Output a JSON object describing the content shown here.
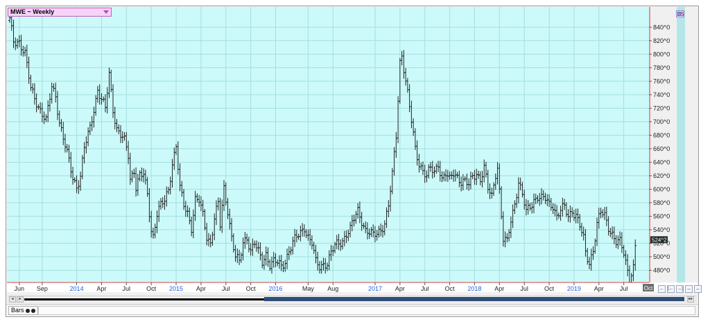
{
  "window": {
    "symbol_label": "MWE ~ Weekly",
    "price_badge": "524^2",
    "current_date_tag": "Oct",
    "bs_badge": {
      "b": "B",
      "s": "S"
    },
    "chart_style_tab": "Bars",
    "nav_buttons": [
      "←",
      "|←",
      "→|",
      "↔",
      "↔"
    ],
    "scroll_arrows": [
      "◂",
      "▸",
      "▸▸"
    ]
  },
  "colors": {
    "plot_bg": "#ccfafa",
    "grid": "#a5dede",
    "bars": "#202020",
    "cursor_line": "#d83030",
    "year_label": "#2060e0",
    "right_panel": "#b3e6e6"
  },
  "chart_data": {
    "type": "bar",
    "style": "OHLC weekly bars",
    "title": "",
    "xlabel": "",
    "ylabel": "",
    "grid": true,
    "ylim": [
      462,
      870
    ],
    "y_ticks": [
      "480^0",
      "500^0",
      "520^0",
      "540^0",
      "560^0",
      "580^0",
      "600^0",
      "620^0",
      "640^0",
      "660^0",
      "680^0",
      "700^0",
      "720^0",
      "740^0",
      "760^0",
      "780^0",
      "800^0",
      "820^0",
      "840^0"
    ],
    "y_tick_values": [
      480,
      500,
      520,
      540,
      560,
      580,
      600,
      620,
      640,
      660,
      680,
      700,
      720,
      740,
      760,
      780,
      800,
      820,
      840
    ],
    "x_ticks": [
      {
        "label": "Jun",
        "year": false,
        "week": 5
      },
      {
        "label": "Sep",
        "year": false,
        "week": 17
      },
      {
        "label": "2014",
        "year": true,
        "week": 35
      },
      {
        "label": "Apr",
        "year": false,
        "week": 48
      },
      {
        "label": "Jul",
        "year": false,
        "week": 61
      },
      {
        "label": "Oct",
        "year": false,
        "week": 74
      },
      {
        "label": "2015",
        "year": true,
        "week": 87
      },
      {
        "label": "Apr",
        "year": false,
        "week": 100
      },
      {
        "label": "Jul",
        "year": false,
        "week": 113
      },
      {
        "label": "Oct",
        "year": false,
        "week": 126
      },
      {
        "label": "2016",
        "year": true,
        "week": 139
      },
      {
        "label": "May",
        "year": false,
        "week": 156
      },
      {
        "label": "Aug",
        "year": false,
        "week": 169
      },
      {
        "label": "2017",
        "year": true,
        "week": 191
      },
      {
        "label": "Apr",
        "year": false,
        "week": 204
      },
      {
        "label": "Jul",
        "year": false,
        "week": 217
      },
      {
        "label": "Oct",
        "year": false,
        "week": 230
      },
      {
        "label": "2018",
        "year": true,
        "week": 243
      },
      {
        "label": "Apr",
        "year": false,
        "week": 256
      },
      {
        "label": "Jul",
        "year": false,
        "week": 269
      },
      {
        "label": "Oct",
        "year": false,
        "week": 282
      },
      {
        "label": "2019",
        "year": true,
        "week": 295
      },
      {
        "label": "Apr",
        "year": false,
        "week": 308
      },
      {
        "label": "Jul",
        "year": false,
        "week": 321
      }
    ],
    "weeks_total": 332,
    "current_price": 524.25,
    "anchors": [
      [
        0,
        850
      ],
      [
        2,
        818
      ],
      [
        5,
        820
      ],
      [
        8,
        800
      ],
      [
        11,
        748
      ],
      [
        14,
        730
      ],
      [
        17,
        712
      ],
      [
        19,
        700
      ],
      [
        22,
        752
      ],
      [
        24,
        740
      ],
      [
        26,
        700
      ],
      [
        28,
        675
      ],
      [
        31,
        640
      ],
      [
        33,
        618
      ],
      [
        35,
        605
      ],
      [
        37,
        620
      ],
      [
        39,
        660
      ],
      [
        42,
        690
      ],
      [
        44,
        720
      ],
      [
        46,
        748
      ],
      [
        48,
        732
      ],
      [
        50,
        718
      ],
      [
        52,
        770
      ],
      [
        54,
        720
      ],
      [
        56,
        690
      ],
      [
        58,
        680
      ],
      [
        60,
        670
      ],
      [
        62,
        650
      ],
      [
        63,
        615
      ],
      [
        65,
        630
      ],
      [
        66,
        605
      ],
      [
        68,
        620
      ],
      [
        70,
        620
      ],
      [
        72,
        592
      ],
      [
        74,
        540
      ],
      [
        75,
        532
      ],
      [
        77,
        565
      ],
      [
        79,
        575
      ],
      [
        81,
        582
      ],
      [
        83,
        600
      ],
      [
        85,
        640
      ],
      [
        87,
        665
      ],
      [
        89,
        600
      ],
      [
        91,
        575
      ],
      [
        93,
        565
      ],
      [
        95,
        545
      ],
      [
        97,
        585
      ],
      [
        99,
        582
      ],
      [
        101,
        560
      ],
      [
        103,
        530
      ],
      [
        105,
        522
      ],
      [
        107,
        558
      ],
      [
        109,
        578
      ],
      [
        110,
        545
      ],
      [
        112,
        600
      ],
      [
        114,
        570
      ],
      [
        116,
        530
      ],
      [
        118,
        500
      ],
      [
        120,
        490
      ],
      [
        122,
        520
      ],
      [
        124,
        530
      ],
      [
        126,
        510
      ],
      [
        128,
        520
      ],
      [
        130,
        505
      ],
      [
        132,
        492
      ],
      [
        134,
        505
      ],
      [
        136,
        490
      ],
      [
        138,
        492
      ],
      [
        140,
        490
      ],
      [
        142,
        485
      ],
      [
        144,
        495
      ],
      [
        146,
        510
      ],
      [
        148,
        520
      ],
      [
        150,
        528
      ],
      [
        152,
        535
      ],
      [
        154,
        545
      ],
      [
        156,
        530
      ],
      [
        158,
        520
      ],
      [
        160,
        490
      ],
      [
        162,
        485
      ],
      [
        164,
        490
      ],
      [
        166,
        492
      ],
      [
        168,
        505
      ],
      [
        170,
        515
      ],
      [
        172,
        520
      ],
      [
        174,
        525
      ],
      [
        176,
        535
      ],
      [
        178,
        540
      ],
      [
        180,
        555
      ],
      [
        182,
        568
      ],
      [
        184,
        555
      ],
      [
        186,
        540
      ],
      [
        188,
        535
      ],
      [
        190,
        530
      ],
      [
        192,
        535
      ],
      [
        194,
        542
      ],
      [
        196,
        550
      ],
      [
        198,
        575
      ],
      [
        200,
        620
      ],
      [
        202,
        680
      ],
      [
        204,
        790
      ],
      [
        205,
        800
      ],
      [
        206,
        780
      ],
      [
        208,
        740
      ],
      [
        210,
        700
      ],
      [
        212,
        660
      ],
      [
        214,
        640
      ],
      [
        216,
        628
      ],
      [
        218,
        618
      ],
      [
        220,
        630
      ],
      [
        222,
        625
      ],
      [
        224,
        640
      ],
      [
        226,
        615
      ],
      [
        228,
        622
      ],
      [
        230,
        612
      ],
      [
        232,
        625
      ],
      [
        234,
        620
      ],
      [
        236,
        612
      ],
      [
        238,
        610
      ],
      [
        240,
        605
      ],
      [
        242,
        620
      ],
      [
        244,
        625
      ],
      [
        246,
        615
      ],
      [
        248,
        630
      ],
      [
        250,
        600
      ],
      [
        252,
        590
      ],
      [
        254,
        625
      ],
      [
        255,
        635
      ],
      [
        257,
        560
      ],
      [
        258,
        525
      ],
      [
        260,
        520
      ],
      [
        262,
        555
      ],
      [
        264,
        580
      ],
      [
        266,
        612
      ],
      [
        268,
        590
      ],
      [
        270,
        565
      ],
      [
        272,
        575
      ],
      [
        274,
        585
      ],
      [
        276,
        590
      ],
      [
        278,
        585
      ],
      [
        280,
        585
      ],
      [
        282,
        578
      ],
      [
        284,
        578
      ],
      [
        286,
        560
      ],
      [
        288,
        568
      ],
      [
        290,
        572
      ],
      [
        292,
        560
      ],
      [
        294,
        570
      ],
      [
        296,
        562
      ],
      [
        298,
        545
      ],
      [
        300,
        525
      ],
      [
        301,
        505
      ],
      [
        303,
        492
      ],
      [
        305,
        512
      ],
      [
        307,
        548
      ],
      [
        309,
        565
      ],
      [
        311,
        560
      ],
      [
        313,
        545
      ],
      [
        315,
        535
      ],
      [
        317,
        522
      ],
      [
        319,
        520
      ],
      [
        321,
        505
      ],
      [
        323,
        480
      ],
      [
        324,
        470
      ],
      [
        326,
        485
      ],
      [
        327,
        515
      ]
    ]
  }
}
